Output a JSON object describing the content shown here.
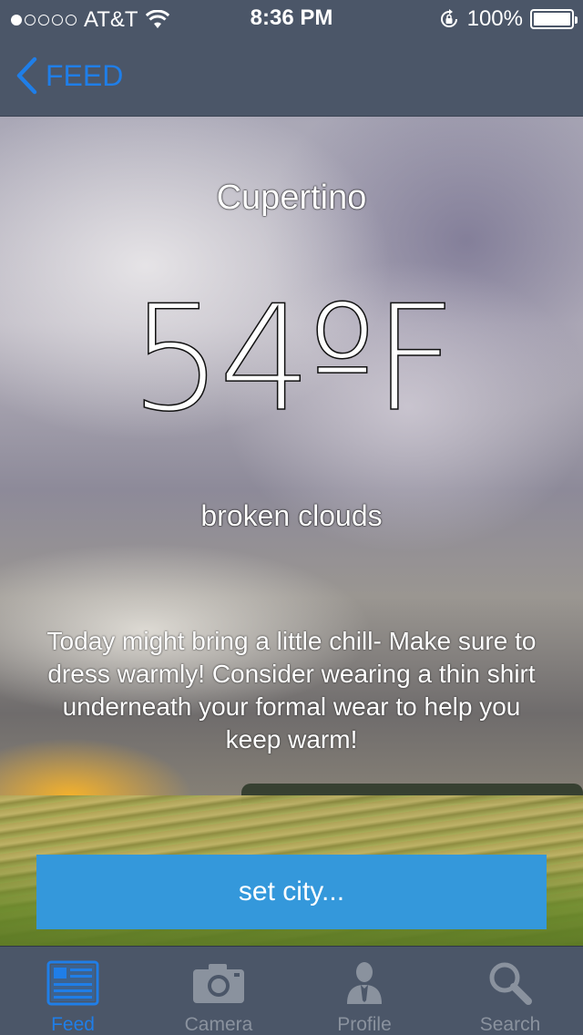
{
  "status_bar": {
    "carrier": "AT&T",
    "time": "8:36 PM",
    "battery": "100%",
    "signal_bars_filled": 1,
    "signal_bars_total": 5
  },
  "nav": {
    "back_label": "FEED"
  },
  "weather": {
    "city": "Cupertino",
    "temperature": "54ºF",
    "condition": "broken clouds",
    "advice": "Today might bring a little chill- Make sure to dress warmly! Consider wearing a thin shirt underneath your formal wear to help you keep warm!"
  },
  "set_city_button": {
    "label": "set city..."
  },
  "tab_bar": {
    "tabs": [
      {
        "label": "Feed",
        "icon": "feed-icon",
        "active": true
      },
      {
        "label": "Camera",
        "icon": "camera-icon",
        "active": false
      },
      {
        "label": "Profile",
        "icon": "profile-icon",
        "active": false
      },
      {
        "label": "Search",
        "icon": "search-icon",
        "active": false
      }
    ]
  },
  "colors": {
    "accent": "#1f7ee8",
    "button": "#3498db",
    "bar_background": "#4b5668",
    "inactive_tab": "#8a929e"
  }
}
